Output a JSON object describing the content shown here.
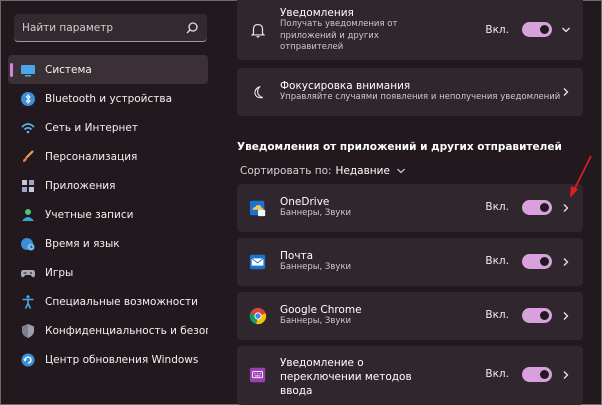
{
  "search": {
    "placeholder": "Найти параметр",
    "icon": "search-icon"
  },
  "sidebar": {
    "items": [
      {
        "label": "Система",
        "icon": "system-display-icon",
        "active": true
      },
      {
        "label": "Bluetooth и устройства",
        "icon": "bluetooth-icon"
      },
      {
        "label": "Сеть и Интернет",
        "icon": "wifi-icon"
      },
      {
        "label": "Персонализация",
        "icon": "brush-icon"
      },
      {
        "label": "Приложения",
        "icon": "apps-grid-icon"
      },
      {
        "label": "Учетные записи",
        "icon": "user-icon"
      },
      {
        "label": "Время и язык",
        "icon": "globe-clock-icon"
      },
      {
        "label": "Игры",
        "icon": "gamepad-icon"
      },
      {
        "label": "Специальные возможности",
        "icon": "accessibility-icon"
      },
      {
        "label": "Конфиденциальность и безопасность",
        "icon": "shield-icon"
      },
      {
        "label": "Центр обновления Windows",
        "icon": "update-icon"
      }
    ]
  },
  "notifications": {
    "title": "Уведомления",
    "subtitle": "Получать уведомления от приложений и других отправителей",
    "toggle_label": "Вкл.",
    "enabled": true
  },
  "focus": {
    "title": "Фокусировка внимания",
    "subtitle": "Управляйте случаями появления и неполучения уведомлений"
  },
  "section_title": "Уведомления от приложений и других отправителей",
  "sort": {
    "label": "Сортировать по:",
    "value": "Недавние"
  },
  "apps": [
    {
      "name": "OneDrive",
      "sub": "Баннеры, Звуки",
      "toggle_label": "Вкл.",
      "enabled": true,
      "icon": "onedrive-icon"
    },
    {
      "name": "Почта",
      "sub": "Баннеры, Звуки",
      "toggle_label": "Вкл.",
      "enabled": true,
      "icon": "mail-icon"
    },
    {
      "name": "Google Chrome",
      "sub": "Баннеры, Звуки",
      "toggle_label": "Вкл.",
      "enabled": true,
      "icon": "chrome-icon"
    },
    {
      "name": "Уведомление о переключении методов ввода",
      "sub": "",
      "toggle_label": "Вкл.",
      "enabled": true,
      "icon": "input-method-icon"
    }
  ],
  "colors": {
    "accent": "#d8a0dc",
    "arrow": "#e02020",
    "background": "#22191f",
    "card": "#2f272d"
  }
}
